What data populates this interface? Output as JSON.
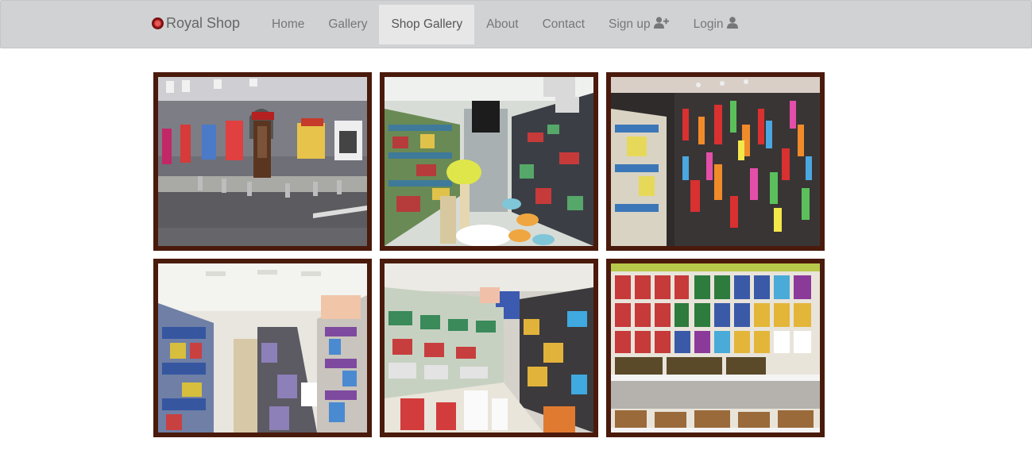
{
  "navbar": {
    "brand": "Royal Shop",
    "items": [
      {
        "label": "Home",
        "active": false
      },
      {
        "label": "Gallery",
        "active": false
      },
      {
        "label": "Shop Gallery",
        "active": true
      },
      {
        "label": "About",
        "active": false
      },
      {
        "label": "Contact",
        "active": false
      },
      {
        "label": "Sign up",
        "active": false,
        "icon": "user-plus-icon"
      },
      {
        "label": "Login",
        "active": false,
        "icon": "user-icon"
      }
    ]
  },
  "gallery": {
    "frame_color": "#4a1a0c",
    "photos": [
      {
        "subject": "shop-exterior"
      },
      {
        "subject": "shop-aisle-toys"
      },
      {
        "subject": "pet-toys-wall"
      },
      {
        "subject": "shop-aisle-food"
      },
      {
        "subject": "shop-aisle-shelves"
      },
      {
        "subject": "treats-display"
      }
    ]
  },
  "colors": {
    "navbar_bg": "#d1d2d4",
    "nav_active_bg": "#e7e7e7",
    "nav_text": "#777777"
  }
}
